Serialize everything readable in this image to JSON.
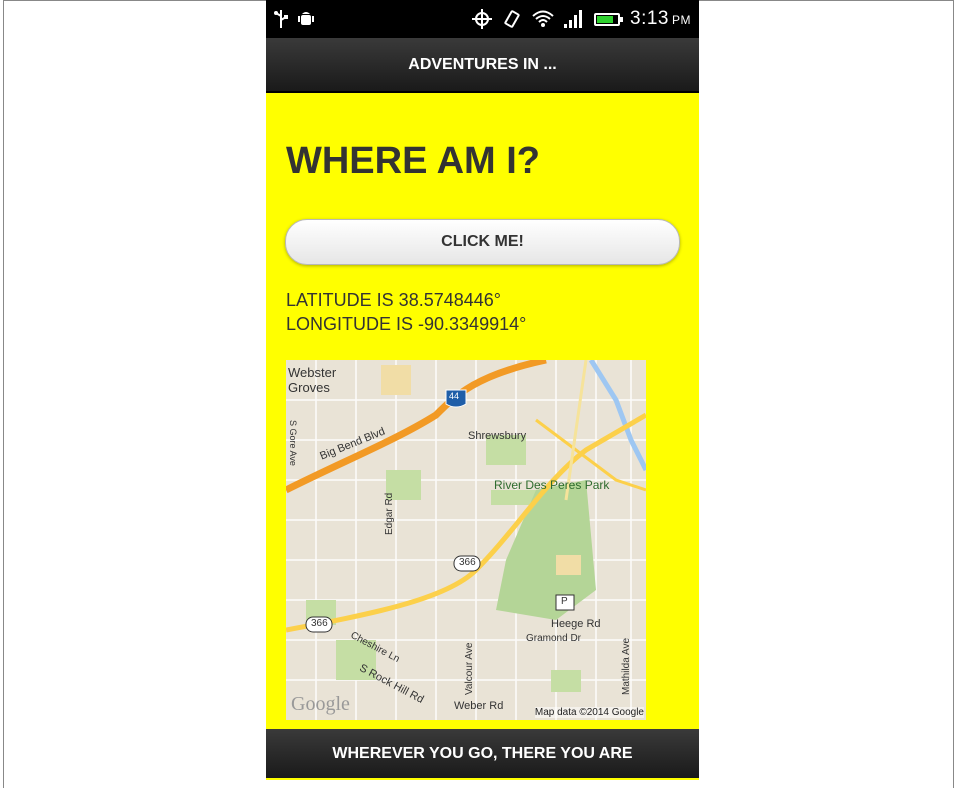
{
  "statusbar": {
    "time": "3:13",
    "ampm": "PM",
    "icons": [
      "usb-icon",
      "android-debug-icon",
      "gps-icon",
      "vibrate-icon",
      "wifi-icon",
      "signal-icon",
      "battery-icon"
    ]
  },
  "header": {
    "title": "ADVENTURES IN ..."
  },
  "main": {
    "heading": "WHERE AM I?",
    "button_label": "CLICK ME!",
    "latitude_text": "LATITUDE IS 38.5748446°",
    "longitude_text": "LONGITUDE IS -90.3349914°"
  },
  "map": {
    "labels": {
      "webster": "Webster",
      "groves": "Groves",
      "gore_ave": "S Gore Ave",
      "big_bend": "Big Bend Blvd",
      "shrewsbury": "Shrewsbury",
      "river_park": "River Des Peres Park",
      "edgar_rd": "Edgar Rd",
      "route_366_a": "366",
      "route_366_b": "366",
      "route_44": "44",
      "heege_rd": "Heege Rd",
      "gramond_dr": "Gramond Dr",
      "cheshire_ln": "Cheshire Ln",
      "rock_hill": "S Rock Hill Rd",
      "valcour_ave": "Valcour Ave",
      "mathilda_ave": "Mathilda Ave",
      "weber_rd": "Weber Rd",
      "parking": "P"
    },
    "logo": "Google",
    "attribution": "Map data ©2014 Google"
  },
  "footer": {
    "text": "WHEREVER YOU GO, THERE YOU ARE"
  },
  "colors": {
    "background": "#ffff00",
    "bar": "#1f1f1f"
  }
}
